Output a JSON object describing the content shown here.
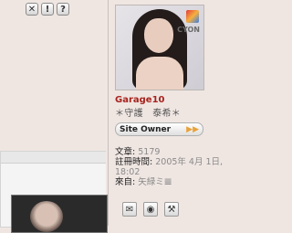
{
  "toolbar": {
    "icons": [
      {
        "name": "delete-icon",
        "glyph": "✕"
      },
      {
        "name": "report-icon",
        "glyph": "!"
      },
      {
        "name": "help-icon",
        "glyph": "?"
      }
    ]
  },
  "profile": {
    "avatar_brand": "CYON",
    "username": "Garage10",
    "subtitle": "＊守護　泰希＊",
    "rank": "Site Owner",
    "rank_arrow": "▶▶",
    "posts_label": "文章:",
    "posts_value": "5179",
    "registered_label": "註冊時間:",
    "registered_value": "2005年 4月 1日,",
    "registered_time": "18:02",
    "from_label": "來自:",
    "from_value": "矢緑ミ𝌆"
  },
  "actions": {
    "icons": [
      {
        "name": "message-icon",
        "glyph": "✉"
      },
      {
        "name": "website-icon",
        "glyph": "◉"
      },
      {
        "name": "tools-icon",
        "glyph": "⚒"
      }
    ]
  },
  "colors": {
    "background": "#efe6e2",
    "username": "#a8231d",
    "rank_arrow": "#e8a23a"
  }
}
